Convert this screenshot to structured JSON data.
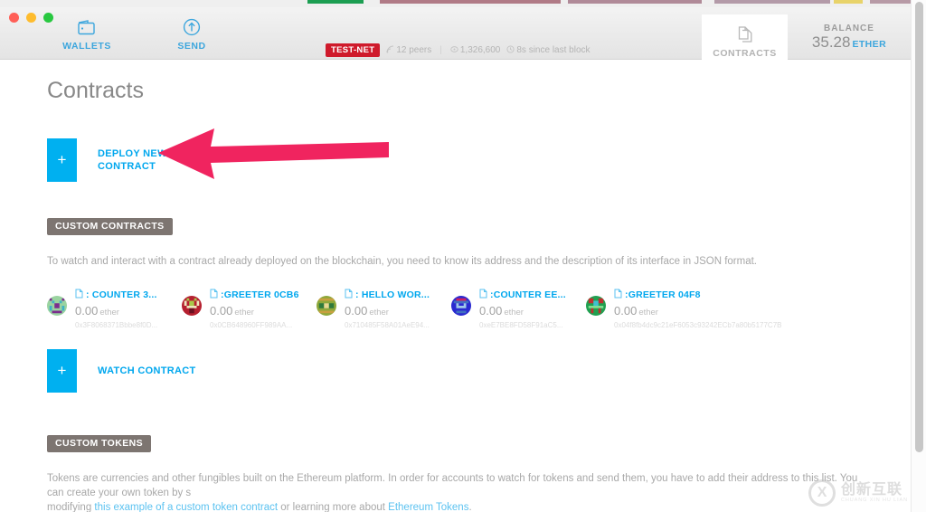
{
  "window": {
    "traffic_lights": [
      "close",
      "minimize",
      "maximize"
    ]
  },
  "nav": {
    "items": [
      {
        "label": "WALLETS",
        "icon": "wallet-icon"
      },
      {
        "label": "SEND",
        "icon": "send-arrow-up-icon"
      }
    ],
    "contracts_tab": {
      "label": "CONTRACTS",
      "icon": "documents-icon",
      "active": true
    }
  },
  "status": {
    "network_badge": "TEST-NET",
    "peers": "12 peers",
    "separator": "|",
    "block_number": "1,326,600",
    "last_block": "8s since last block",
    "peers_icon": "signal-icon",
    "block_icon": "block-icon",
    "clock_icon": "clock-icon"
  },
  "balance": {
    "title": "BALANCE",
    "value": "35.28",
    "unit": "ETHER"
  },
  "page": {
    "title": "Contracts"
  },
  "deploy": {
    "plus": "+",
    "label": "DEPLOY NEW CONTRACT"
  },
  "custom_contracts": {
    "heading": "CUSTOM CONTRACTS",
    "description": "To watch and interact with a contract already deployed on the blockchain, you need to know its address and the description of its interface in JSON format.",
    "items": [
      {
        "name": ": COUNTER 3...",
        "amount": "0.00",
        "unit": "ether",
        "address": "0x3F8068371Bbbe8f0D...",
        "identicon_colors": [
          "#7fbf8f",
          "#9b3fa0",
          "#3fb2c4",
          "#e0e0c0"
        ]
      },
      {
        "name": ":GREETER 0CB6",
        "amount": "0.00",
        "unit": "ether",
        "address": "0x0CB648960FF989AA...",
        "identicon_colors": [
          "#c02030",
          "#8fbf3f",
          "#efe0b0",
          "#6a1020"
        ]
      },
      {
        "name": ": HELLO WOR...",
        "amount": "0.00",
        "unit": "ether",
        "address": "0x710485F58A01AeE94...",
        "identicon_colors": [
          "#7a9a30",
          "#c8a040",
          "#3f7f3f",
          "#e8d890"
        ]
      },
      {
        "name": ":COUNTER EE...",
        "amount": "0.00",
        "unit": "ether",
        "address": "0xeE7BE8FD58F91aC5...",
        "identicon_colors": [
          "#2a2ad0",
          "#d02060",
          "#4070c0",
          "#a0c8e8"
        ]
      },
      {
        "name": ":GREETER 04F8",
        "amount": "0.00",
        "unit": "ether",
        "address": "0x04f8fb4dc9c21eF6053c93242ECb7a80b5177C7B",
        "identicon_colors": [
          "#20a050",
          "#c03030",
          "#40c0d0",
          "#80e090"
        ]
      }
    ],
    "watch": {
      "plus": "+",
      "label": "WATCH CONTRACT"
    }
  },
  "custom_tokens": {
    "heading": "CUSTOM TOKENS",
    "description_part1": "Tokens are currencies and other fungibles built on the Ethereum platform. In order for accounts to watch for tokens and send them, you have to add their address to this list. You can create your own token by s",
    "description_part2": "modifying ",
    "link1": "this example of a custom token contract",
    "description_part3": " or learning more about ",
    "link2": "Ethereum Tokens",
    "description_part4": "."
  },
  "annotation": {
    "arrow_color": "#f0245f",
    "arrow_points_to": "deploy-new-contract"
  },
  "watermark": {
    "cn": "创新互联",
    "en": "CHUANG XIN HU LIAN",
    "mark": "X"
  },
  "colors": {
    "accent_blue": "#00a7ee",
    "plus_button": "#00b0f0",
    "testnet_red": "#cf1a2b",
    "section_head": "#7d7571",
    "arrow_pink": "#f0245f"
  }
}
